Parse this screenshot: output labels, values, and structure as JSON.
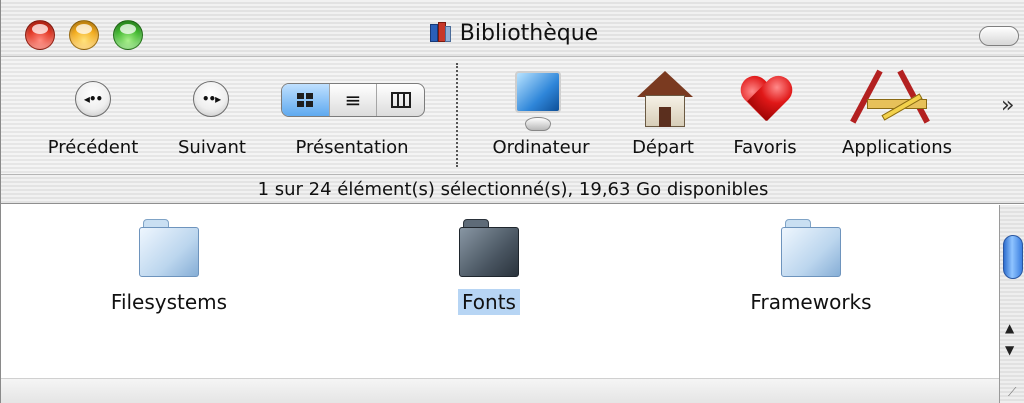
{
  "window": {
    "title": "Bibliothèque"
  },
  "toolbar": {
    "back_label": "Précédent",
    "forward_label": "Suivant",
    "view_label": "Présentation",
    "computer_label": "Ordinateur",
    "home_label": "Départ",
    "favorites_label": "Favoris",
    "applications_label": "Applications",
    "overflow_glyph": "»",
    "view_selected": "icon"
  },
  "status": {
    "text": "1 sur 24 élément(s) sélectionné(s), 19,63 Go disponibles"
  },
  "files": [
    {
      "name": "Filesystems",
      "selected": false,
      "icon": "folder-icon"
    },
    {
      "name": "Fonts",
      "selected": true,
      "icon": "folder-icon"
    },
    {
      "name": "Frameworks",
      "selected": false,
      "icon": "folder-icon"
    }
  ],
  "colors": {
    "selection": "#b7d5f4",
    "scroll_thumb": "#3b7fe0",
    "close": "#e0311e",
    "minimize": "#f2a818",
    "zoom": "#3bb52a"
  }
}
